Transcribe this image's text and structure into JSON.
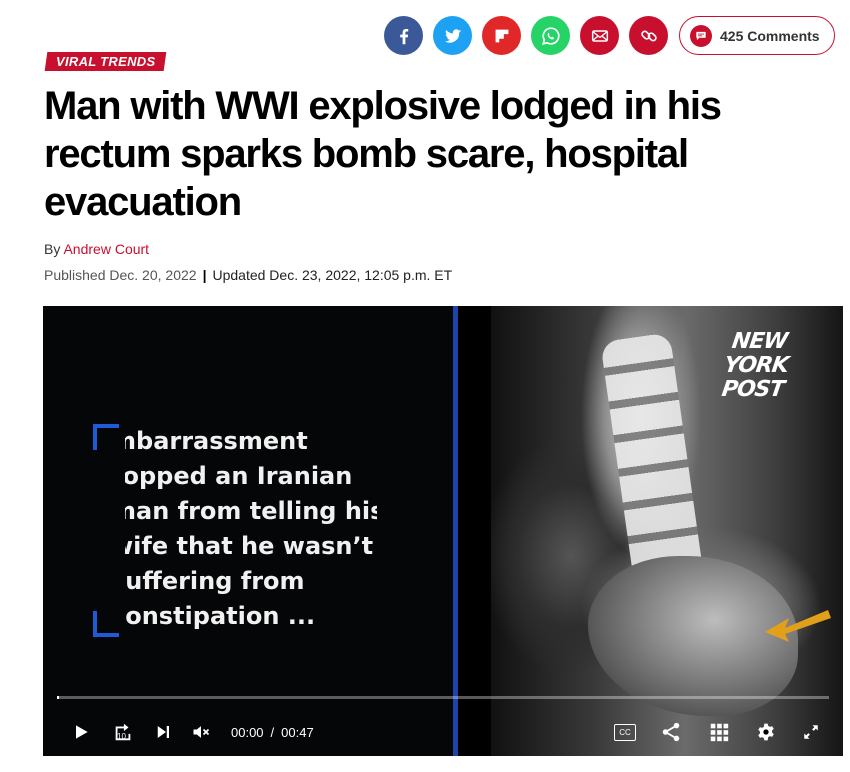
{
  "share": {
    "buttons": [
      {
        "name": "facebook",
        "icon": "facebook-icon",
        "color": "#3b5998"
      },
      {
        "name": "twitter",
        "icon": "twitter-icon",
        "color": "#1da1f2"
      },
      {
        "name": "flipboard",
        "icon": "flipboard-icon",
        "color": "#e12828"
      },
      {
        "name": "whatsapp",
        "icon": "whatsapp-icon",
        "color": "#25d366"
      },
      {
        "name": "email",
        "icon": "email-icon",
        "color": "#c8102e"
      },
      {
        "name": "link",
        "icon": "link-icon",
        "color": "#c8102e"
      }
    ],
    "comments_label": "425 Comments"
  },
  "article": {
    "kicker": "VIRAL TRENDS",
    "headline": "Man with WWI explosive lodged in his rectum sparks bomb scare, hospital evacuation",
    "byline_prefix": "By",
    "author": "Andrew Court",
    "published": "Published Dec. 20, 2022",
    "updated": "Updated Dec. 23, 2022, 12:05 p.m. ET"
  },
  "video": {
    "quote_lines": [
      "mbarrassment",
      "topped an Iranian",
      "man from telling his",
      "wife that he wasn’t",
      "suffering from",
      "constipation ..."
    ],
    "logo_lines": [
      "NEW",
      "YORK",
      "POST"
    ],
    "current_time": "00:00",
    "time_separator": "/",
    "duration": "00:47",
    "progress_fraction": 0.0,
    "icons": [
      "play-icon",
      "rewind-10-icon",
      "next-icon",
      "mute-icon",
      "captions-icon",
      "share-icon",
      "grid-icon",
      "settings-icon",
      "fullscreen-icon"
    ],
    "replay_seconds": "10",
    "cc_label": "CC",
    "accent_color": "#1d44a8",
    "arrow_color": "#e2a01a"
  },
  "colors": {
    "brand_red": "#c8102e"
  }
}
